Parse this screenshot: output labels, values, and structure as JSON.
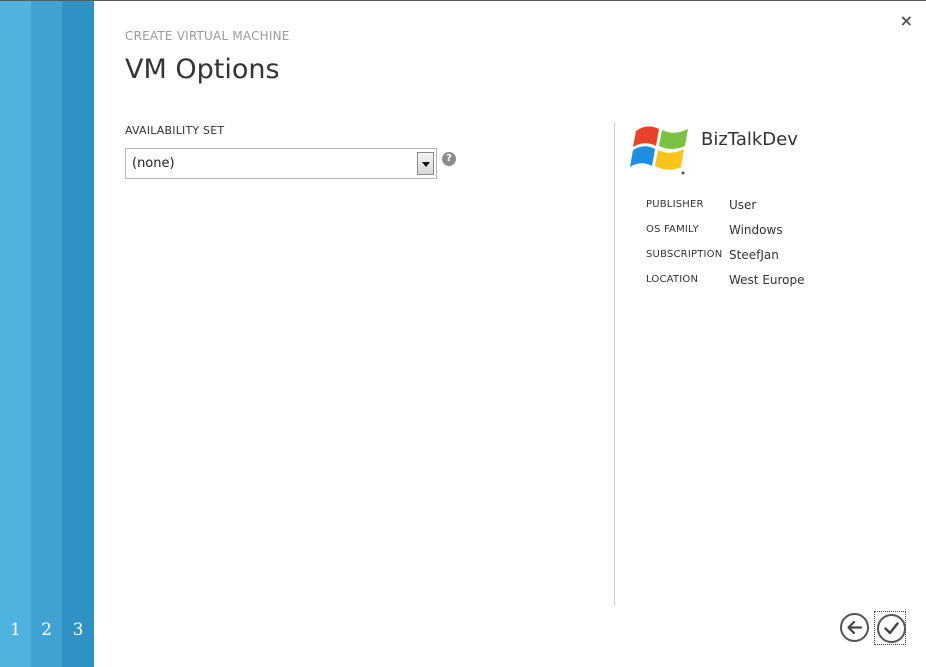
{
  "steps": [
    "1",
    "2",
    "3"
  ],
  "header": {
    "subtitle": "CREATE VIRTUAL MACHINE",
    "title": "VM Options"
  },
  "form": {
    "availability_set": {
      "label": "AVAILABILITY SET",
      "value": "(none)"
    },
    "help_glyph": "?"
  },
  "summary": {
    "icon": "windows-logo-icon",
    "name": "BizTalkDev",
    "details": [
      {
        "key": "PUBLISHER",
        "value": "User"
      },
      {
        "key": "OS FAMILY",
        "value": "Windows"
      },
      {
        "key": "SUBSCRIPTION",
        "value": "SteefJan"
      },
      {
        "key": "LOCATION",
        "value": "West Europe"
      }
    ]
  },
  "controls": {
    "close_glyph": "×",
    "back_icon": "arrow-left-icon",
    "finish_icon": "checkmark-icon"
  },
  "colors": {
    "step1": "#4fb3e0",
    "step2": "#3fa2d2",
    "step3": "#2f92c4"
  }
}
